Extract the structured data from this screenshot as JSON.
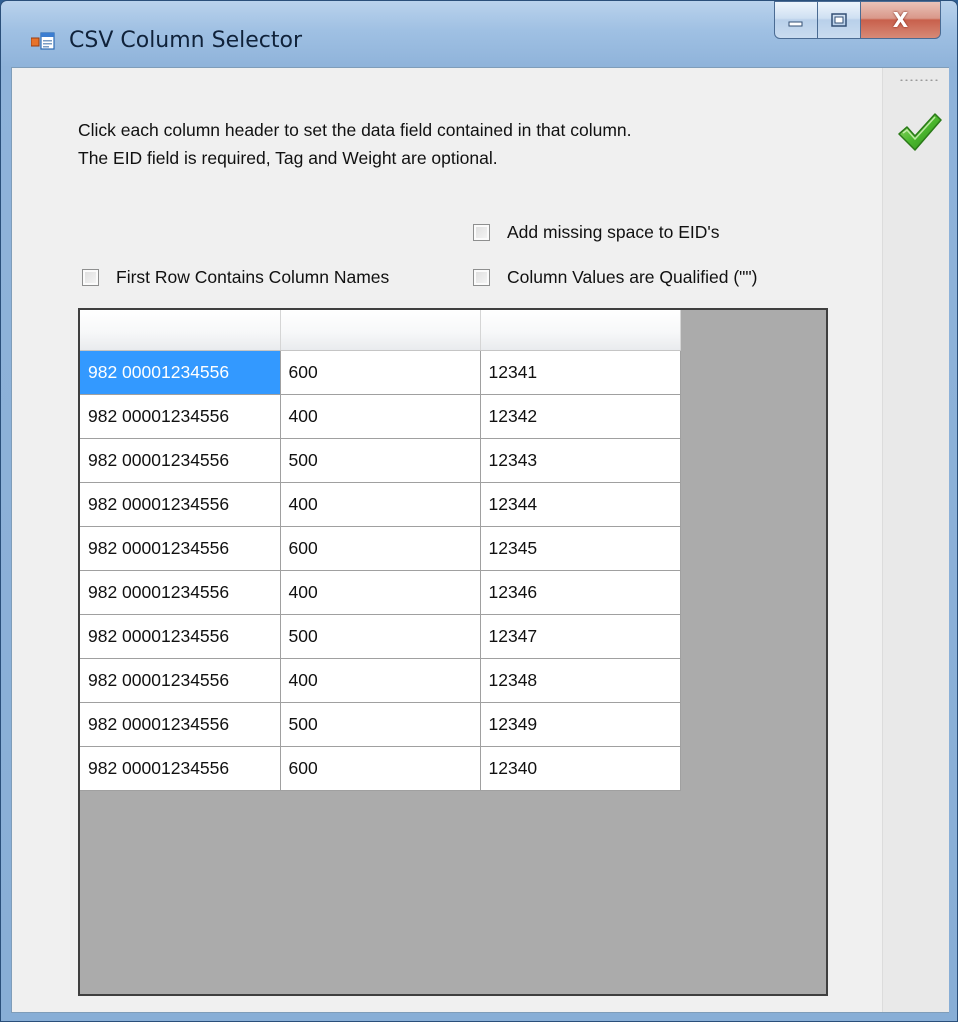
{
  "window": {
    "title": "CSV Column Selector",
    "close_glyph": "X"
  },
  "instructions": {
    "line1": "Click each column header to set the data field contained in that column.",
    "line2": "The EID field is required, Tag and Weight are optional."
  },
  "options": {
    "add_missing_space_label": "Add missing space to EID's",
    "first_row_names_label": "First Row Contains Column Names",
    "qualified_values_label": "Column Values are Qualified (\"\")"
  },
  "grid": {
    "headers": [
      "",
      "",
      ""
    ],
    "rows": [
      [
        "982 00001234556",
        "600",
        "12341"
      ],
      [
        "982 00001234556",
        "400",
        "12342"
      ],
      [
        "982 00001234556",
        "500",
        "12343"
      ],
      [
        "982 00001234556",
        "400",
        "12344"
      ],
      [
        "982 00001234556",
        "600",
        "12345"
      ],
      [
        "982 00001234556",
        "400",
        "12346"
      ],
      [
        "982 00001234556",
        "500",
        "12347"
      ],
      [
        "982 00001234556",
        "400",
        "12348"
      ],
      [
        "982 00001234556",
        "500",
        "12349"
      ],
      [
        "982 00001234556",
        "600",
        "12340"
      ]
    ]
  },
  "icons": {
    "app": "app-icon",
    "minimize": "minimize-icon",
    "maximize": "maximize-icon",
    "close": "close-icon",
    "ok": "checkmark-icon"
  },
  "colors": {
    "selection": "#3399ff",
    "grid_background": "#ababab",
    "checkmark": "#3fae2a"
  }
}
